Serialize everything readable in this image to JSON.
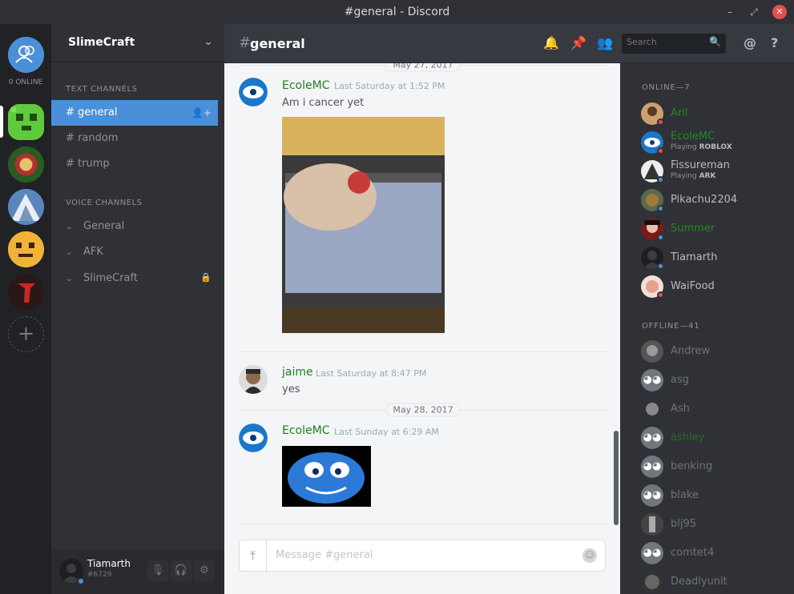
{
  "window": {
    "title": "#general - Discord",
    "min": "–",
    "restore": "⤢",
    "close": "✕"
  },
  "guilds": {
    "online_label": "0 ONLINE",
    "add_label": "+"
  },
  "server": {
    "name": "SlimeCraft",
    "chevron": "⌄"
  },
  "text_channels": {
    "header": "TEXT CHANNELS",
    "items": [
      {
        "label": "# general",
        "active": true
      },
      {
        "label": "# random"
      },
      {
        "label": "# trump"
      }
    ],
    "invite_icon": "add-user-icon"
  },
  "voice_channels": {
    "header": "VOICE CHANNELS",
    "items": [
      {
        "label": "General"
      },
      {
        "label": "AFK"
      },
      {
        "label": "SlimeCraft",
        "locked": true
      }
    ]
  },
  "user": {
    "name": "Tiamarth",
    "discriminator": "#6729"
  },
  "chat": {
    "channel": "general",
    "search_placeholder": "Search"
  },
  "messages": {
    "dates": [
      "May 27, 2017",
      "May 28, 2017"
    ],
    "items": [
      {
        "author": "EcoleMC",
        "time": "Last Saturday at 1:52 PM",
        "text": "Am i cancer yet"
      },
      {
        "author": "jaime",
        "time": "Last Saturday at 8:47 PM",
        "text": "yes"
      },
      {
        "author": "EcoleMC",
        "time": "Last Sunday at 6:29 AM",
        "text": ""
      }
    ],
    "input_placeholder": "Message #general"
  },
  "members": {
    "online_header": "ONLINE—7",
    "offline_header": "OFFLINE—41",
    "online": [
      {
        "name": "Aril",
        "status": "dnd",
        "color": "#1f8b1f"
      },
      {
        "name": "EcoleMC",
        "status": "dnd",
        "color": "#1f8b1f",
        "playing": "Playing",
        "game": "ROBLOX"
      },
      {
        "name": "Fissureman",
        "status": "online",
        "color": "#b9bbbe",
        "playing": "Playing",
        "game": "ARK"
      },
      {
        "name": "Pikachu2204",
        "status": "online",
        "color": "#b9bbbe"
      },
      {
        "name": "Summer",
        "status": "online",
        "color": "#1f8b1f"
      },
      {
        "name": "Tiamarth",
        "status": "online",
        "color": "#b9bbbe"
      },
      {
        "name": "WaiFood",
        "status": "dnd",
        "color": "#b9bbbe"
      }
    ],
    "offline": [
      {
        "name": "Andrew"
      },
      {
        "name": "asg"
      },
      {
        "name": "Ash"
      },
      {
        "name": "ashley"
      },
      {
        "name": "benking"
      },
      {
        "name": "blake"
      },
      {
        "name": "blj95"
      },
      {
        "name": "comtet4"
      },
      {
        "name": "Deadlyunit"
      }
    ]
  },
  "colors": {
    "accent": "#4a90d9",
    "online": "#43b581",
    "dnd": "#f04747",
    "username_green": "#1e7e1e"
  }
}
